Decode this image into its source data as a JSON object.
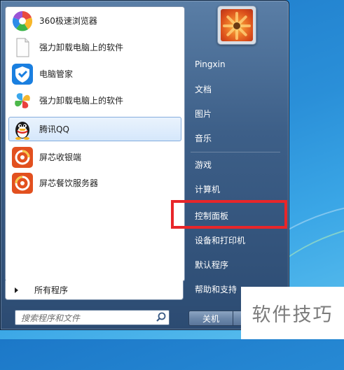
{
  "start_menu": {
    "programs": [
      {
        "label": "360极速浏览器",
        "icon": "360-browser-icon"
      },
      {
        "label": "强力卸载电脑上的软件",
        "icon": "blank-document-icon"
      },
      {
        "label": "电脑管家",
        "icon": "tencent-pc-manager-icon"
      },
      {
        "label": "强力卸载电脑上的软件",
        "icon": "uninstaller-icon"
      },
      {
        "label": "腾讯QQ",
        "icon": "qq-penguin-icon",
        "selected": true
      },
      {
        "label": "屏芯收银端",
        "icon": "pingxin-cashier-icon"
      },
      {
        "label": "屏芯餐饮服务器",
        "icon": "pingxin-server-icon"
      }
    ],
    "all_programs_label": "所有程序",
    "search_placeholder": "搜索程序和文件",
    "right_items": [
      {
        "label": "Pingxin"
      },
      {
        "label": "文档"
      },
      {
        "label": "图片"
      },
      {
        "label": "音乐"
      },
      {
        "label": "游戏"
      },
      {
        "label": "计算机"
      },
      {
        "label": "控制面板"
      },
      {
        "label": "设备和打印机"
      },
      {
        "label": "默认程序"
      },
      {
        "label": "帮助和支持"
      }
    ],
    "shutdown_label": "关机",
    "highlight_color": "#e8262a"
  },
  "watermark_text": "软件技巧"
}
